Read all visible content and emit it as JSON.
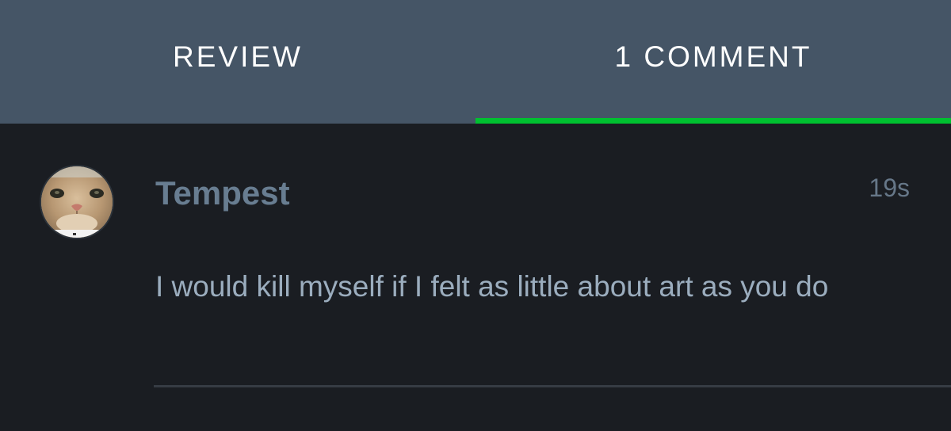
{
  "tabs": [
    {
      "label": "REVIEW",
      "active": false
    },
    {
      "label": "1 COMMENT",
      "active": true
    }
  ],
  "colors": {
    "header_bg": "#455566",
    "active_indicator": "#00c030",
    "page_bg": "#1a1d22",
    "username": "#687d91",
    "comment_text": "#9badbe"
  },
  "comment": {
    "username": "Tempest",
    "timestamp": "19s",
    "text": "I would kill myself if I felt as little about art as you do",
    "avatar_icon": "cat-face-avatar"
  }
}
